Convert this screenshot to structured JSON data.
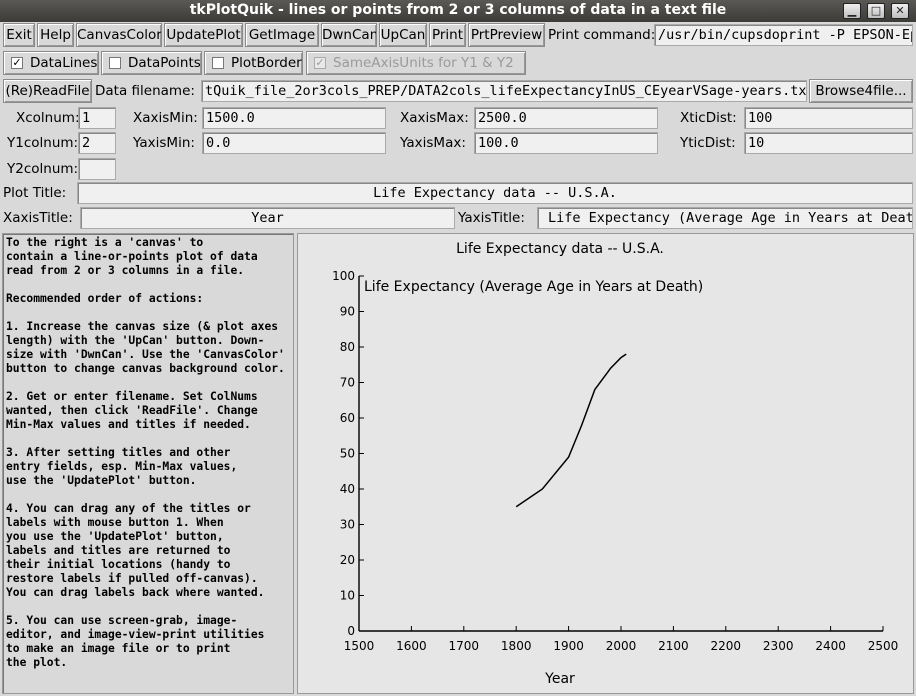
{
  "window": {
    "title": "tkPlotQuik - lines or points from 2 or 3 columns of data in a text file",
    "controls": {
      "minimize": "▁",
      "maximize": "□",
      "close": "✕"
    }
  },
  "toolbar": {
    "exit": "Exit",
    "help": "Help",
    "canvas_color": "CanvasColor",
    "update_plot": "UpdatePlot",
    "get_image": "GetImage",
    "dwn_can": "DwnCan",
    "up_can": "UpCan",
    "print": "Print",
    "prt_preview": "PrtPreview",
    "print_command_label": "Print command:",
    "print_command_value": "/usr/bin/cupsdoprint -P EPSON-Ep"
  },
  "options": {
    "data_lines": {
      "label": "DataLines",
      "checked": "✓"
    },
    "data_points": {
      "label": "DataPoints",
      "checked": ""
    },
    "plot_border": {
      "label": "PlotBorder",
      "checked": ""
    },
    "same_axis_units": {
      "label": "SameAxisUnits for Y1 & Y2",
      "checked": "✓"
    }
  },
  "file": {
    "read_file": "(Re)ReadFile",
    "filename_label": "Data filename:",
    "filename_value": "tQuik_file_2or3cols_PREP/DATA2cols_lifeExpectancyInUS_CEyearVSage-years.txt",
    "browse": "Browse4file..."
  },
  "fields": {
    "xcolnum_label": "Xcolnum:",
    "xcolnum": "1",
    "y1colnum_label": "Y1colnum:",
    "y1colnum": "2",
    "y2colnum_label": "Y2colnum:",
    "y2colnum": "",
    "xaxismin_label": "XaxisMin:",
    "xaxismin": "1500.0",
    "xaxismax_label": "XaxisMax:",
    "xaxismax": "2500.0",
    "xticdist_label": "XticDist:",
    "xticdist": "100",
    "yaxismin_label": "YaxisMin:",
    "yaxismin": "0.0",
    "yaxismax_label": "YaxisMax:",
    "yaxismax": "100.0",
    "yticdist_label": "YticDist:",
    "yticdist": "10",
    "plot_title_label": "Plot Title:",
    "plot_title": "Life Expectancy data -- U.S.A.",
    "xaxis_title_label": "XaxisTitle:",
    "xaxis_title": "Year",
    "yaxis_title_label": "YaxisTitle:",
    "yaxis_title": "Life Expectancy (Average Age in Years at Death)"
  },
  "help_text": "To the right is a 'canvas' to\ncontain a line-or-points plot of data\nread from 2 or 3 columns in a file.\n\nRecommended order of actions:\n\n1. Increase the canvas size (& plot axes\nlength) with the 'UpCan' button. Down-\nsize with 'DwnCan'. Use the 'CanvasColor'\nbutton to change canvas background color.\n\n2. Get or enter filename. Set ColNums\nwanted, then click 'ReadFile'. Change\nMin-Max values and titles if needed.\n\n3. After setting titles and other\nentry fields, esp. Min-Max values,\nuse the 'UpdatePlot' button.\n\n4. You can drag any of the titles or\nlabels with mouse button 1. When\nyou use the 'UpdatePlot' button,\nlabels and titles are returned to\ntheir initial locations (handy to\nrestore labels if pulled off-canvas).\nYou can drag labels back where wanted.\n\n5. You can use screen-grab, image-\neditor, and image-view-print utilities\nto make an image file or to print\nthe plot.",
  "chart_data": {
    "type": "line",
    "title": "Life Expectancy data -- U.S.A.",
    "xlabel": "Year",
    "ylabel": "Life Expectancy (Average Age in Years at Death)",
    "xlim": [
      1500,
      2500
    ],
    "ylim": [
      0,
      100
    ],
    "xticks": [
      1500,
      1600,
      1700,
      1800,
      1900,
      2000,
      2100,
      2200,
      2300,
      2400,
      2500
    ],
    "yticks": [
      0,
      10,
      20,
      30,
      40,
      50,
      60,
      70,
      80,
      90,
      100
    ],
    "series": [
      {
        "x": [
          1800,
          1850,
          1900,
          1925,
          1950,
          1975,
          1980,
          2000,
          2010
        ],
        "y": [
          35,
          40,
          49,
          58,
          68,
          73,
          74,
          77,
          78
        ]
      }
    ],
    "line_color": "#000000",
    "grid": false
  }
}
